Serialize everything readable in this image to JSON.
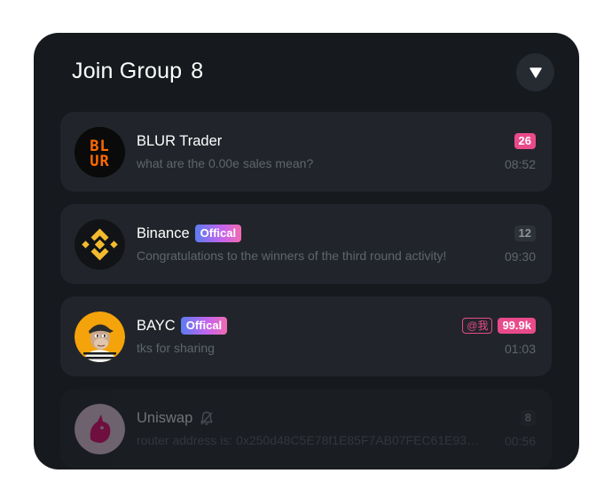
{
  "header": {
    "title": "Join Group",
    "count": "8",
    "dropdown_icon": "triangle-down-icon"
  },
  "groups": [
    {
      "name": "BLUR Trader",
      "avatar": "blur-logo",
      "official_label": "",
      "message": "what are the 0.00e sales mean?",
      "time": "08:52",
      "unread": "26",
      "unread_style": "pink",
      "mention": "",
      "muted": false
    },
    {
      "name": "Binance",
      "avatar": "binance-logo",
      "official_label": "Offical",
      "message": "Congratulations to the winners of the third round activity!",
      "time": "09:30",
      "unread": "12",
      "unread_style": "dark",
      "mention": "",
      "muted": false
    },
    {
      "name": "BAYC",
      "avatar": "bayc-ape-avatar",
      "official_label": "Offical",
      "message": "tks for sharing",
      "time": "01:03",
      "unread": "99.9k",
      "unread_style": "pink",
      "mention": "@我",
      "muted": false
    },
    {
      "name": "Uniswap",
      "avatar": "uniswap-unicorn-logo",
      "official_label": "",
      "message": "router address is: 0x250d48C5E78f1E85F7AB07FEC61E93b...",
      "time": "00:56",
      "unread": "8",
      "unread_style": "dark",
      "mention": "",
      "muted": true
    }
  ],
  "colors": {
    "panel_background": "#16191d",
    "card_background": "#21252b",
    "accent_pink": "#e94a8b",
    "binance_yellow": "#f3ba2f",
    "blur_orange": "#ff6a00"
  }
}
